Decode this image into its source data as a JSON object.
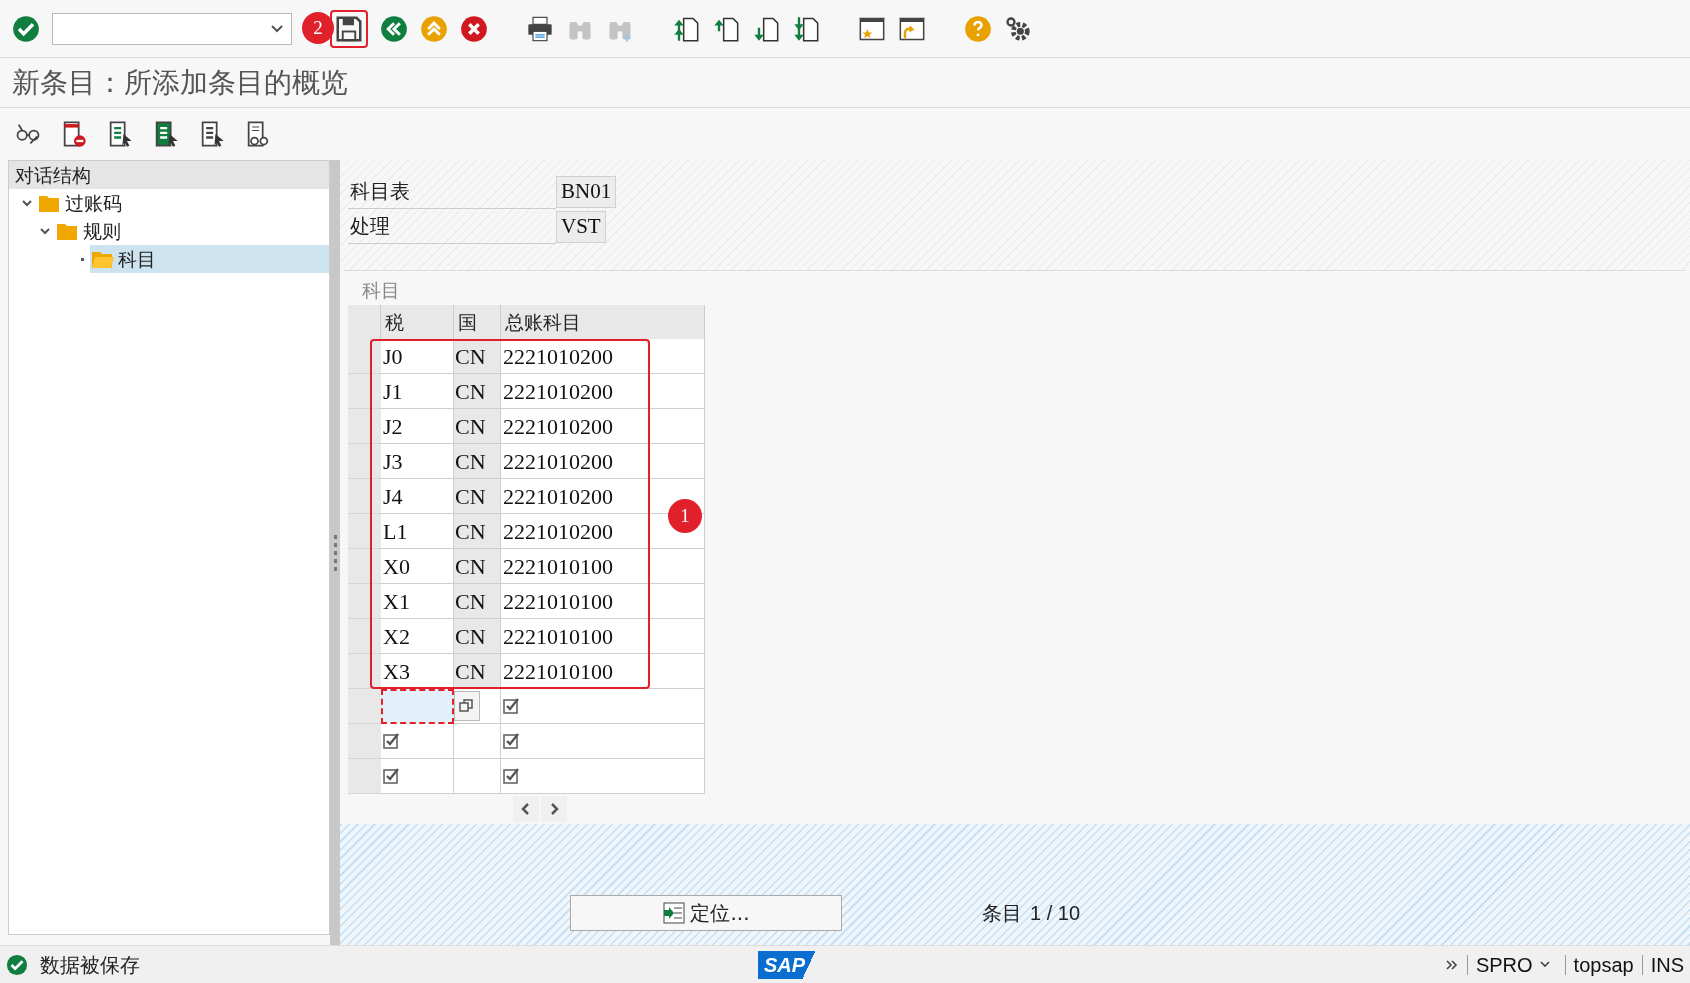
{
  "toolbar": {
    "buttons": [
      {
        "kind": "enter",
        "disabled": false
      },
      {
        "kind": "command"
      },
      {
        "kind": "save",
        "disabled": false,
        "highlighted": true
      },
      {
        "kind": "back",
        "disabled": false
      },
      {
        "kind": "exit",
        "disabled": false
      },
      {
        "kind": "cancel",
        "disabled": false
      },
      {
        "kind": "print",
        "disabled": false
      },
      {
        "kind": "find",
        "disabled": true
      },
      {
        "kind": "find-next",
        "disabled": true
      },
      {
        "kind": "first",
        "disabled": false
      },
      {
        "kind": "prev",
        "disabled": false
      },
      {
        "kind": "next",
        "disabled": false
      },
      {
        "kind": "last",
        "disabled": false
      },
      {
        "kind": "session",
        "disabled": false
      },
      {
        "kind": "shortcut",
        "disabled": false
      },
      {
        "kind": "help",
        "disabled": false
      },
      {
        "kind": "settings",
        "disabled": false
      }
    ]
  },
  "title": "新条目：所添加条目的概览",
  "app_toolbar": [
    {
      "kind": "display"
    },
    {
      "kind": "delete"
    },
    {
      "kind": "select-all"
    },
    {
      "kind": "select-block"
    },
    {
      "kind": "deselect"
    },
    {
      "kind": "compare"
    }
  ],
  "dialog_structure": {
    "title": "对话结构",
    "items": [
      {
        "label": "过账码",
        "expanded": true,
        "selected": false,
        "children": [
          {
            "label": "规则",
            "expanded": true,
            "selected": false,
            "children": [
              {
                "label": "科目",
                "selected": true
              }
            ]
          }
        ]
      }
    ]
  },
  "header_fields": [
    {
      "label": "科目表",
      "value": "BN01"
    },
    {
      "label": "处理",
      "value": "VST"
    }
  ],
  "table": {
    "title": "科目",
    "columns": [
      "税",
      "国",
      "总账科目"
    ],
    "rows": [
      {
        "tax": "J0",
        "country": "CN",
        "account": "2221010200"
      },
      {
        "tax": "J1",
        "country": "CN",
        "account": "2221010200"
      },
      {
        "tax": "J2",
        "country": "CN",
        "account": "2221010200"
      },
      {
        "tax": "J3",
        "country": "CN",
        "account": "2221010200"
      },
      {
        "tax": "J4",
        "country": "CN",
        "account": "2221010200"
      },
      {
        "tax": "L1",
        "country": "CN",
        "account": "2221010200"
      },
      {
        "tax": "X0",
        "country": "CN",
        "account": "2221010100"
      },
      {
        "tax": "X1",
        "country": "CN",
        "account": "2221010100"
      },
      {
        "tax": "X2",
        "country": "CN",
        "account": "2221010100"
      },
      {
        "tax": "X3",
        "country": "CN",
        "account": "2221010100"
      }
    ],
    "empty_rows": [
      {
        "kind": "input",
        "account_checked": true
      },
      {
        "kind": "check",
        "tax_checked": true,
        "account_checked": true
      },
      {
        "kind": "check",
        "tax_checked": true,
        "account_checked": true
      }
    ]
  },
  "position_button": "定位...",
  "entry_label": "条目",
  "entry_count": "1 / 10",
  "annotations": [
    {
      "label": "2"
    },
    {
      "label": "1"
    }
  ],
  "status_bar": {
    "message": "数据被保存",
    "logo": "SAP",
    "transaction": "SPRO",
    "server": "topsap",
    "mode": "INS"
  }
}
